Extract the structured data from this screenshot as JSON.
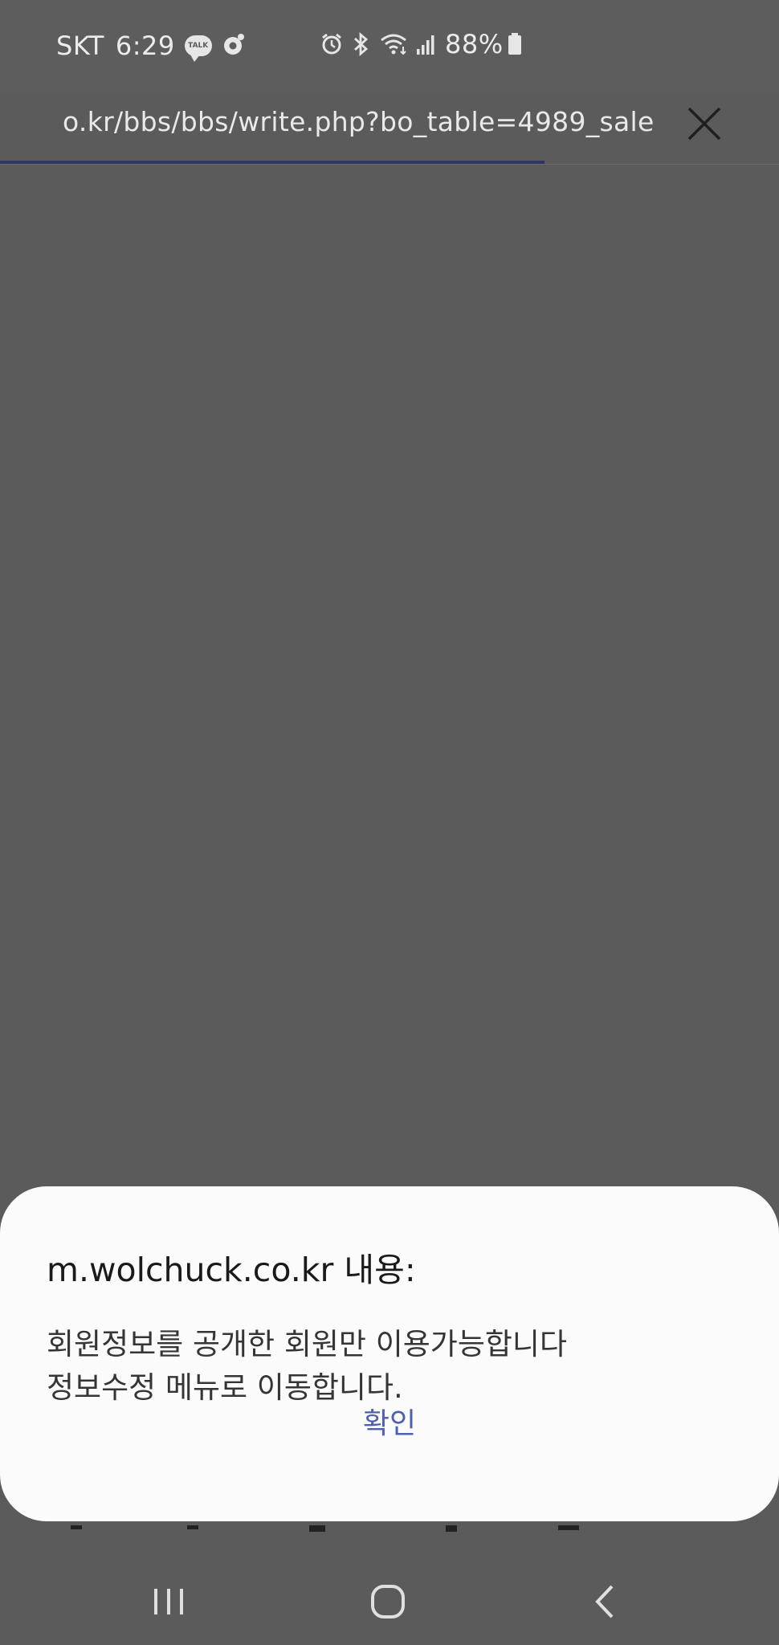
{
  "status_bar": {
    "carrier": "SKT",
    "time": "6:29",
    "talk_badge": "TALK",
    "battery_percent": "88%",
    "icons": [
      "kakaotalk-icon",
      "camera-icon",
      "alarm-icon",
      "bluetooth-icon",
      "wifi-icon",
      "signal-icon",
      "battery-icon"
    ]
  },
  "browser": {
    "url": "o.kr/bbs/bbs/write.php?bo_table=4989_sale",
    "close_icon": "close-icon",
    "progress_color": "#2f3760"
  },
  "dialog": {
    "title": "m.wolchuck.co.kr 내용:",
    "message_line1": "회원정보를 공개한 회원만 이용가능합니다",
    "message_line2": "정보수정 메뉴로 이동합니다.",
    "confirm_label": "확인",
    "confirm_color": "#5060b0"
  },
  "nav_bar": {
    "buttons": [
      "recents-icon",
      "home-icon",
      "back-icon"
    ]
  }
}
